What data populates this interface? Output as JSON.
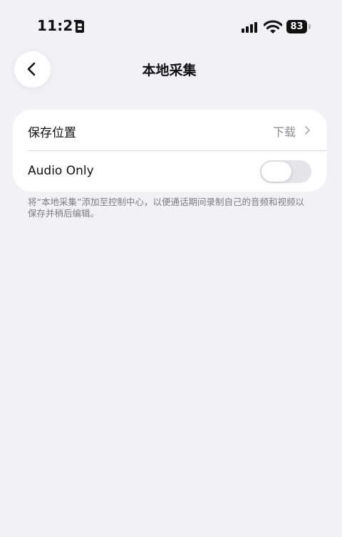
{
  "status_bar": {
    "time": "11:27",
    "battery": "83"
  },
  "nav": {
    "title": "本地采集",
    "back_icon": "chevron-left-icon"
  },
  "settings": {
    "save_location": {
      "label": "保存位置",
      "value": "下载"
    },
    "audio_only": {
      "label": "Audio Only",
      "enabled": false
    },
    "footnote": "将“本地采集”添加至控制中心，以便通话期间录制自己的音频和视频以保存并稍后编辑。"
  },
  "colors": {
    "background": "#f2f1f6",
    "card": "#ffffff",
    "secondary_text": "#8e8e93",
    "toggle_off": "#e4e4e9"
  }
}
